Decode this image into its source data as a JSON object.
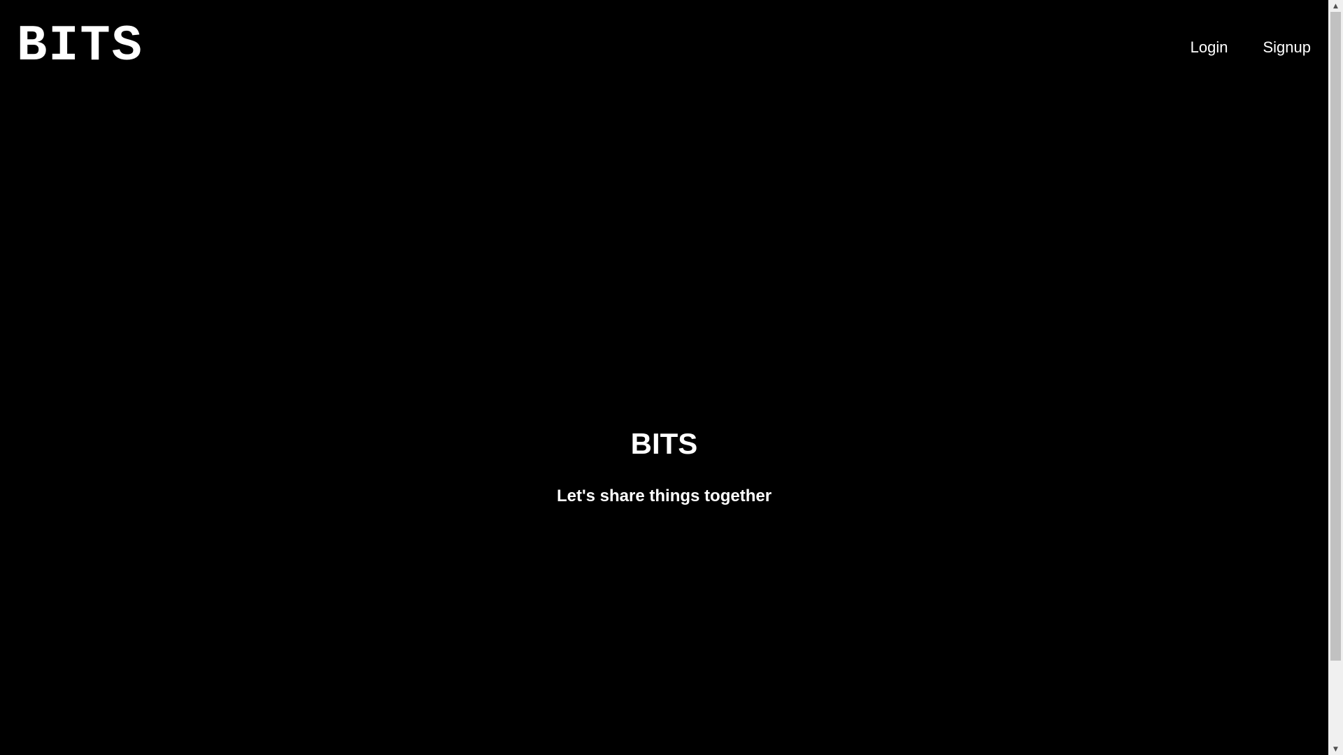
{
  "header": {
    "logo_text": "BITS",
    "nav": {
      "login_label": "Login",
      "signup_label": "Signup"
    }
  },
  "hero": {
    "title": "BITS",
    "tagline": "Let's share things together"
  },
  "scrollbar": {
    "up_arrow_icon": "triangle-up-icon",
    "down_arrow_icon": "triangle-down-icon",
    "thumb_color": "#c1c1c1",
    "track_color": "#f0f0f0"
  },
  "colors": {
    "background": "#000000",
    "text": "#ffffff"
  }
}
